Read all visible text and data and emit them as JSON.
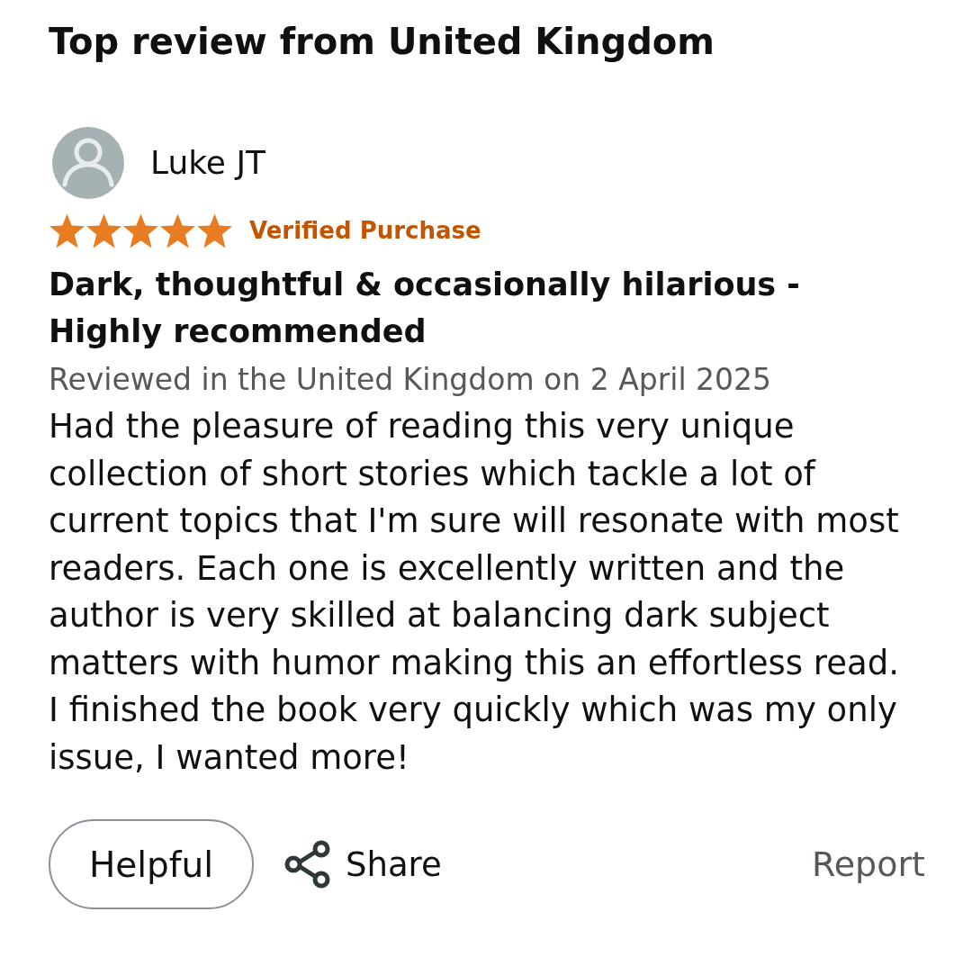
{
  "heading": "Top review from United Kingdom",
  "review": {
    "reviewer": "Luke JT",
    "stars": 5,
    "badge": "Verified Purchase",
    "title": "Dark, thoughtful & occasionally hilarious - Highly recommended",
    "date": "Reviewed in the United Kingdom on 2 April 2025",
    "body": "Had the pleasure of reading this very unique collection of short stories which tackle a lot of current topics that I'm sure will resonate with most readers. Each one is excellently written and the author is very skilled at balancing dark subject matters with humor making this an effortless read. I finished the book very quickly which was my only issue, I wanted more!"
  },
  "actions": [
    {
      "kind": "pill",
      "label": "Helpful"
    },
    {
      "kind": "share",
      "label": "Share"
    },
    {
      "kind": "link",
      "label": "Report"
    }
  ]
}
